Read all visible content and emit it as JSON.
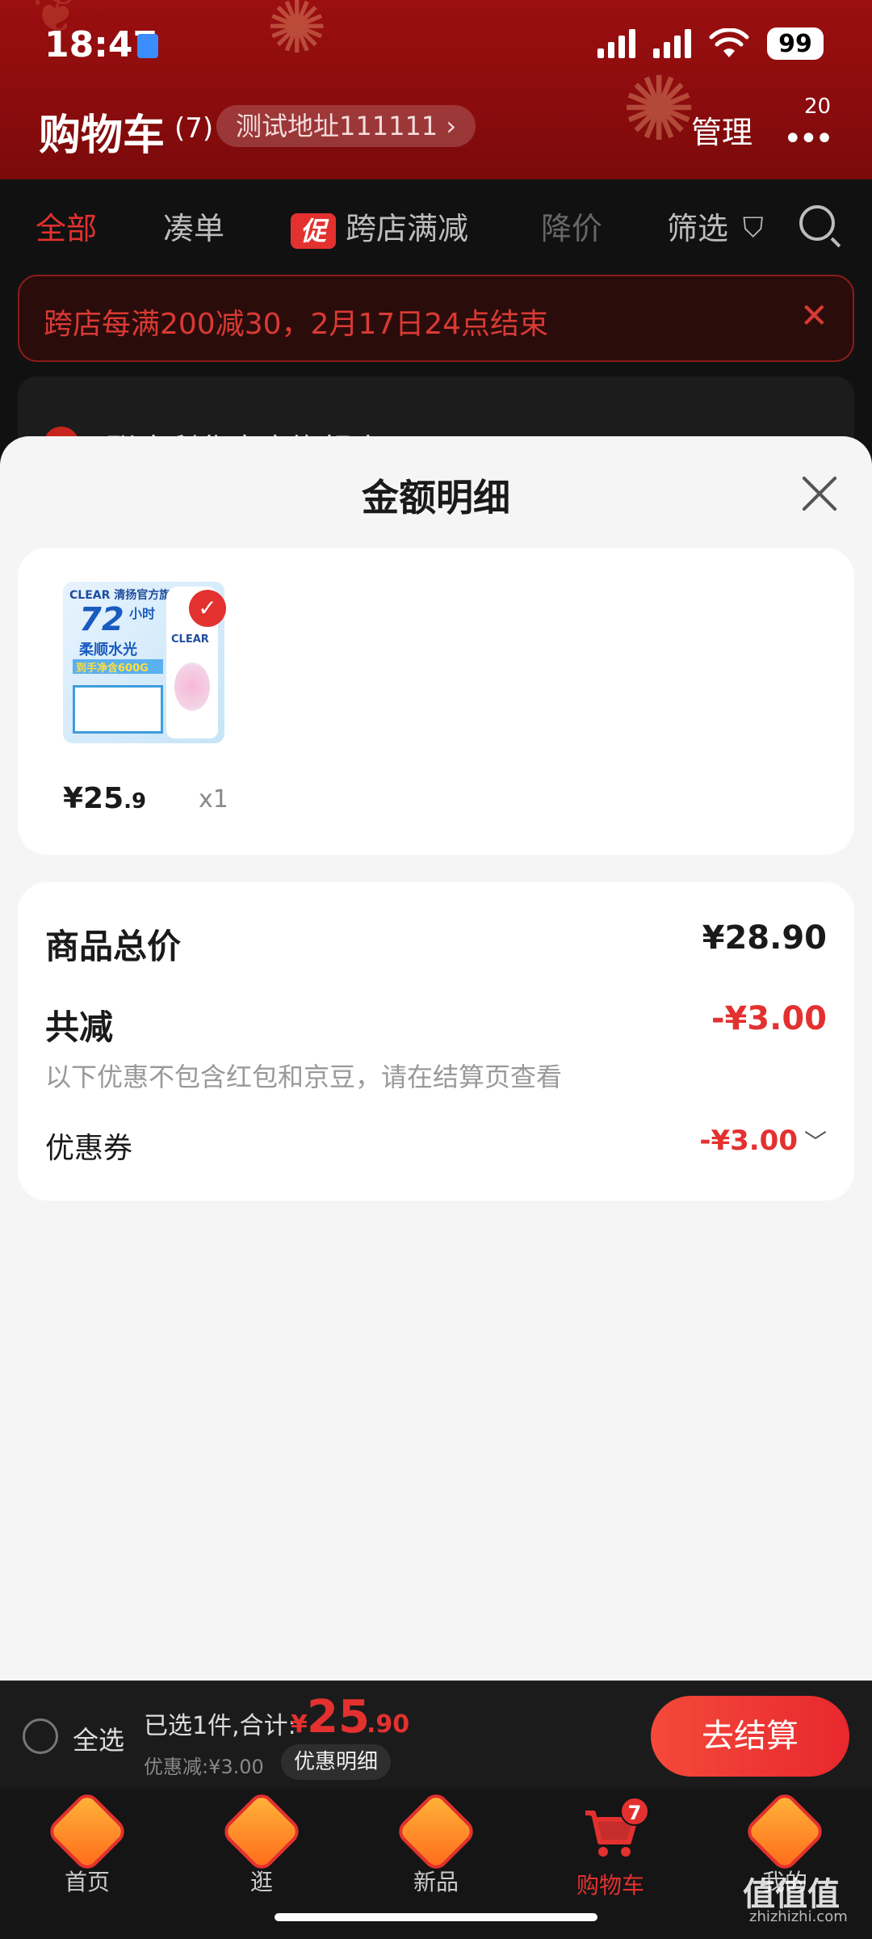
{
  "status_bar": {
    "time": "18:47",
    "battery": "99"
  },
  "header": {
    "title": "购物车",
    "count": "(7)",
    "address": "测试地址111111 ›",
    "manage_label": "管理",
    "more_icon": "more-dots-icon",
    "message_badge": "20"
  },
  "tabs": [
    {
      "label": "全部",
      "active": true
    },
    {
      "label": "凑单"
    },
    {
      "label": "跨店满减",
      "tag": "促"
    },
    {
      "label": "降价",
      "disabled": true
    },
    {
      "label": "筛选"
    }
  ],
  "notice": {
    "text": "跨店每满200减30，2月17日24点结束",
    "close": "✕"
  },
  "shop_peek": {
    "text": "联合利华官方旗舰店 ›"
  },
  "sheet": {
    "title": "金额明细",
    "product": {
      "thumb_brand": "CLEAR 清扬官方旗舰店",
      "thumb_big": "72",
      "thumb_hours": "小时",
      "thumb_sub": "柔顺水光",
      "thumb_strip": "到手净含600G",
      "thumb_bottle_label": "CLEAR",
      "check": "✓",
      "price_int": "¥25",
      "price_dec": ".9",
      "qty": "x1"
    },
    "summary": {
      "total_label": "商品总价",
      "total_value": "¥28.90",
      "reduce_label": "共减",
      "reduce_value": "-¥3.00",
      "note": "以下优惠不包含红包和京豆，请在结算页查看",
      "coupon_label": "优惠券",
      "coupon_value": "-¥3.00",
      "coupon_chevron": "﹀"
    }
  },
  "checkout": {
    "select_all": "全选",
    "selected_text": "已选1件,合计:",
    "total_yen": "¥",
    "total_int": "25",
    "total_dec": ".90",
    "discount_text": "优惠减:¥3.00",
    "detail_label": "优惠明细",
    "button_label": "去结算"
  },
  "tabbar": [
    {
      "label": "首页",
      "icon": "home-icon"
    },
    {
      "label": "逛",
      "icon": "explore-icon"
    },
    {
      "label": "新品",
      "icon": "new-products-icon"
    },
    {
      "label": "购物车",
      "icon": "cart-icon",
      "badge": "7",
      "active": true
    },
    {
      "label": "我的",
      "icon": "profile-icon"
    }
  ],
  "watermark": {
    "main": "值值值",
    "sub": "zhizhizhi.com"
  },
  "colors": {
    "accent": "#e3312f",
    "header_red": "#9b0f10",
    "sheet_bg": "#f5f5f5"
  }
}
